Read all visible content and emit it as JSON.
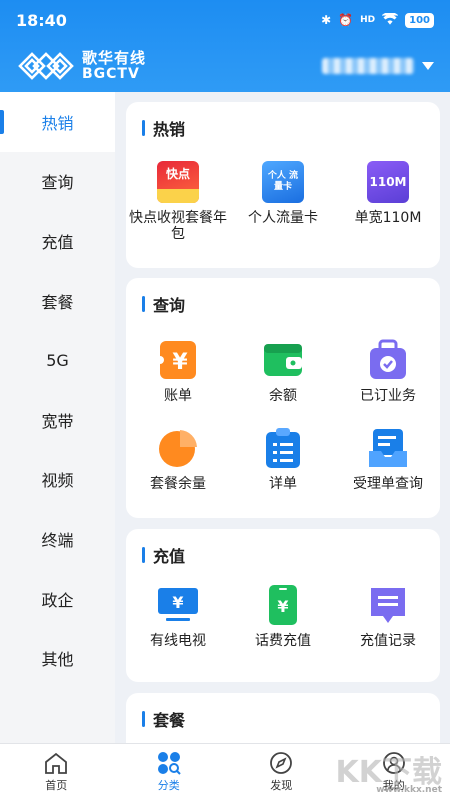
{
  "status": {
    "time": "18:40",
    "battery": "100",
    "signal_label": "HD"
  },
  "brand": {
    "name_cn": "歌华有线",
    "name_en": "BGCTV"
  },
  "sidebar": {
    "items": [
      {
        "label": "热销"
      },
      {
        "label": "查询"
      },
      {
        "label": "充值"
      },
      {
        "label": "套餐"
      },
      {
        "label": "5G"
      },
      {
        "label": "宽带"
      },
      {
        "label": "视频"
      },
      {
        "label": "终端"
      },
      {
        "label": "政企"
      },
      {
        "label": "其他"
      }
    ],
    "active_index": 0
  },
  "sections": {
    "hot": {
      "title": "热销",
      "items": [
        {
          "label": "快点收视套餐年包",
          "icon": "kuaidian-package-icon",
          "icon_text": "快点"
        },
        {
          "label": "个人流量卡",
          "icon": "data-card-icon",
          "icon_text": "个人 流量卡"
        },
        {
          "label": "单宽110M",
          "icon": "broadband-110m-icon",
          "icon_text": "110M"
        }
      ]
    },
    "query": {
      "title": "查询",
      "items": [
        {
          "label": "账单",
          "icon": "bill-icon"
        },
        {
          "label": "余额",
          "icon": "wallet-icon"
        },
        {
          "label": "已订业务",
          "icon": "subscribed-service-icon"
        },
        {
          "label": "套餐余量",
          "icon": "pie-chart-icon"
        },
        {
          "label": "详单",
          "icon": "clipboard-list-icon"
        },
        {
          "label": "受理单查询",
          "icon": "order-inbox-icon"
        }
      ]
    },
    "recharge": {
      "title": "充值",
      "items": [
        {
          "label": "有线电视",
          "icon": "tv-yuan-icon"
        },
        {
          "label": "话费充值",
          "icon": "phone-yuan-icon"
        },
        {
          "label": "充值记录",
          "icon": "record-message-icon"
        }
      ]
    },
    "package": {
      "title": "套餐"
    }
  },
  "bottom_nav": {
    "items": [
      {
        "label": "首页",
        "icon": "home-icon"
      },
      {
        "label": "分类",
        "icon": "category-icon"
      },
      {
        "label": "发现",
        "icon": "compass-icon"
      },
      {
        "label": "我的",
        "icon": "user-icon"
      }
    ],
    "active_index": 1
  },
  "watermark": {
    "text": "KK下载",
    "url": "www.kkx.net"
  },
  "colors": {
    "primary": "#1a7fe8",
    "header": "#1d8df2",
    "orange": "#ff8a1f",
    "green": "#1fbf5f",
    "purple": "#7a6cf0"
  }
}
